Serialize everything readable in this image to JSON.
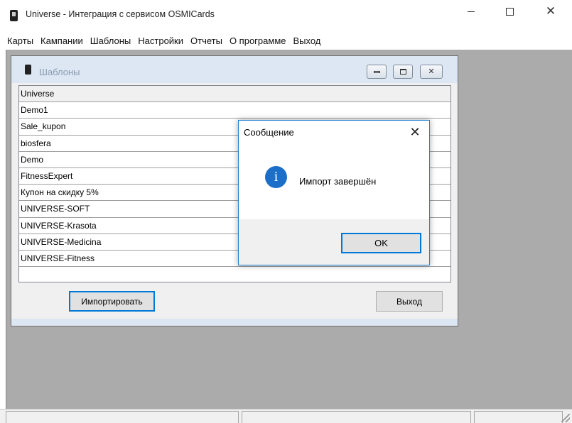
{
  "window": {
    "title": "Universe - Интеграция с сервисом OSMICards",
    "min_label": "—",
    "max_label": "☐",
    "close_label": "✕"
  },
  "menu": [
    "Карты",
    "Кампании",
    "Шаблоны",
    "Настройки",
    "Отчеты",
    "О программе",
    "Выход"
  ],
  "child": {
    "title": "Шаблоны",
    "close_label": "✕",
    "list_header": "Universe",
    "templates": [
      "Demo1",
      "Sale_kupon",
      "biosfera",
      "Demo",
      "FitnessExpert",
      "Купон на скидку 5%",
      "UNIVERSE-SOFT",
      "UNIVERSE-Krasota",
      "UNIVERSE-Medicina",
      "UNIVERSE-Fitness"
    ],
    "import_label": "Импортировать",
    "exit_label": "Выход"
  },
  "message_box": {
    "title": "Сообщение",
    "close_label": "✕",
    "icon_glyph": "i",
    "text": "Импорт завершён",
    "ok_label": "OK"
  }
}
